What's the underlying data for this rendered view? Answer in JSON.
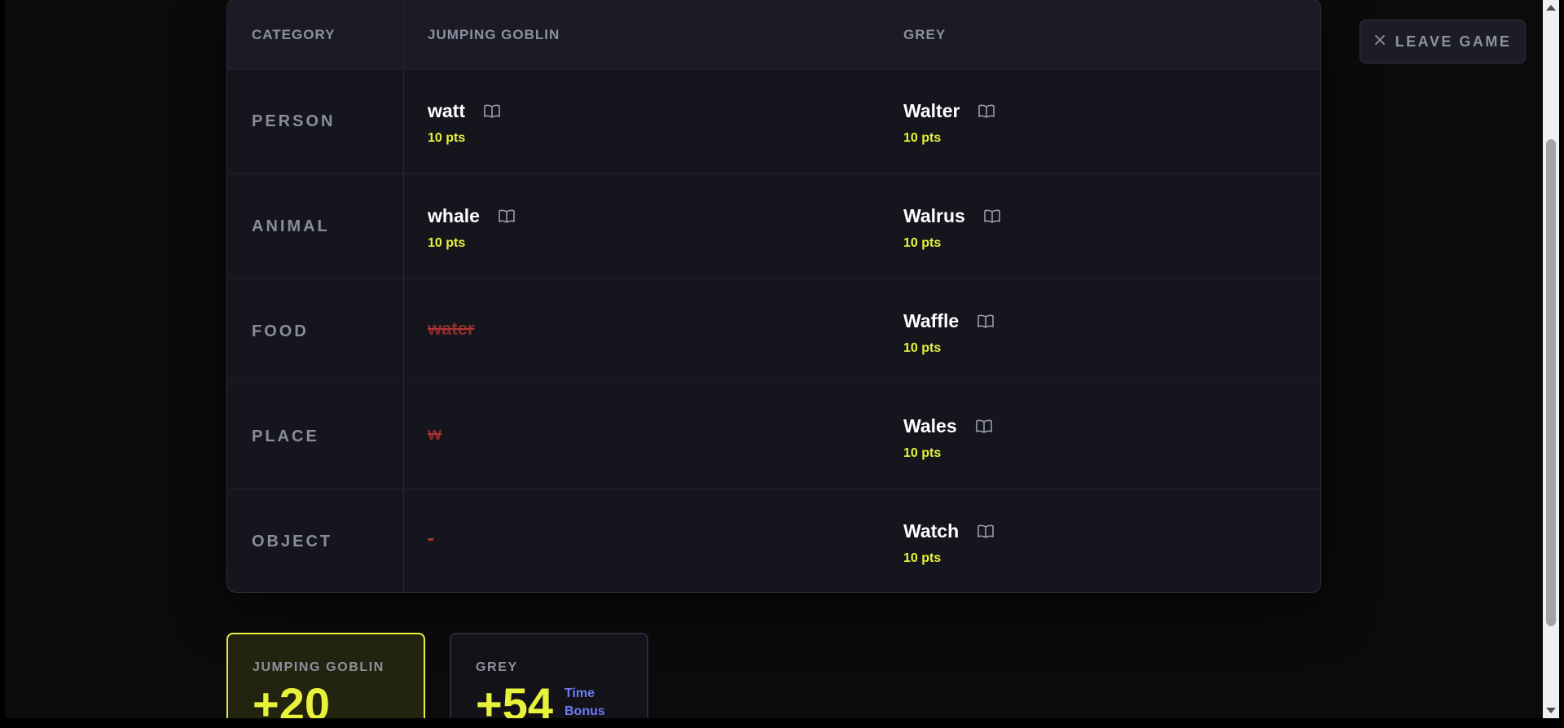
{
  "table": {
    "headers": {
      "category": "CATEGORY",
      "player1": "JUMPING GOBLIN",
      "player2": "GREY"
    },
    "rows": [
      {
        "category": "PERSON",
        "p1": {
          "answer": "watt",
          "points": "10 pts",
          "valid": true
        },
        "p2": {
          "answer": "Walter",
          "points": "10 pts",
          "valid": true
        }
      },
      {
        "category": "ANIMAL",
        "p1": {
          "answer": "whale",
          "points": "10 pts",
          "valid": true
        },
        "p2": {
          "answer": "Walrus",
          "points": "10 pts",
          "valid": true
        }
      },
      {
        "category": "FOOD",
        "p1": {
          "answer": "water",
          "points": "",
          "valid": false
        },
        "p2": {
          "answer": "Waffle",
          "points": "10 pts",
          "valid": true
        }
      },
      {
        "category": "PLACE",
        "p1": {
          "answer": "w",
          "points": "",
          "valid": false
        },
        "p2": {
          "answer": "Wales",
          "points": "10 pts",
          "valid": true
        }
      },
      {
        "category": "OBJECT",
        "p1": {
          "answer": "-",
          "points": "",
          "valid": false
        },
        "p2": {
          "answer": "Watch",
          "points": "10 pts",
          "valid": true
        }
      }
    ]
  },
  "leave_button": {
    "label": "LEAVE GAME",
    "icon": "close-icon"
  },
  "scores": [
    {
      "name": "JUMPING GOBLIN",
      "score": "+20",
      "bonus": ""
    },
    {
      "name": "GREY",
      "score": "+54",
      "bonus_line1": "Time",
      "bonus_line2": "Bonus"
    }
  ],
  "colors": {
    "accent": "#e8f23a",
    "invalid": "#8c2a2a",
    "bonus": "#6b7cf7",
    "background": "#0b0b0c",
    "card": "#15161d"
  },
  "icons": {
    "dictionary": "book-icon"
  }
}
